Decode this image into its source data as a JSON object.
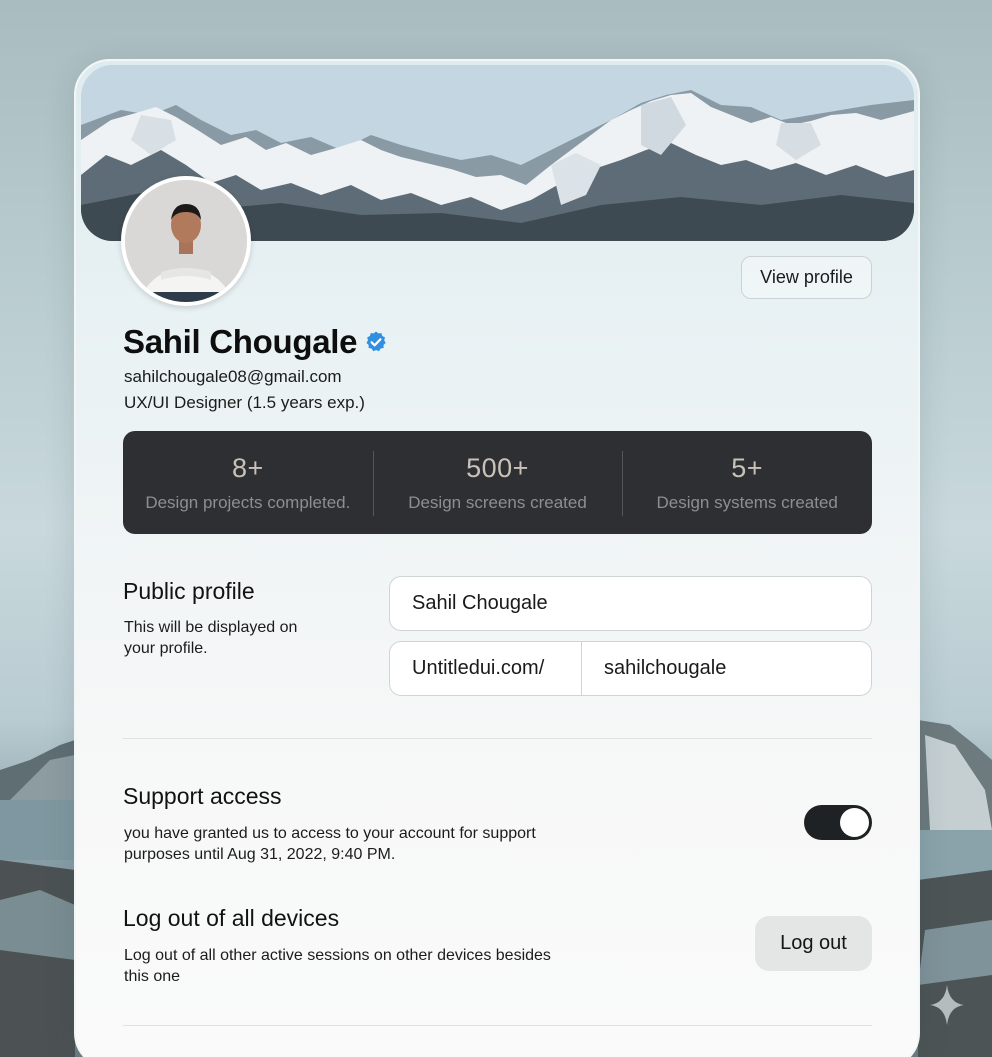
{
  "profile": {
    "name": "Sahil Chougale",
    "email": "sahilchougale08@gmail.com",
    "role": "UX/UI Designer (1.5 years exp.)",
    "view_profile_label": "View profile",
    "verified_icon": "verified-badge-icon",
    "accent_color": "#2f8fe0"
  },
  "stats": [
    {
      "value": "8+",
      "label": "Design projects completed."
    },
    {
      "value": "500+",
      "label": "Design screens created"
    },
    {
      "value": "5+",
      "label": "Design systems created"
    }
  ],
  "public_profile": {
    "title": "Public profile",
    "description_line1": "This will be displayed on",
    "description_line2": "your profile.",
    "name_value": "Sahil Chougale",
    "url_prefix": "Untitledui.com/",
    "url_value": "sahilchougale"
  },
  "support_access": {
    "title": "Support access",
    "description_line1": "you have granted us to access to your account for support",
    "description_line2": "purposes until Aug 31, 2022, 9:40 PM.",
    "toggle_on": true
  },
  "logout_all": {
    "title": "Log out of all devices",
    "description_line1": "Log out of all other active sessions on other devices besides",
    "description_line2": "this one",
    "button_label": "Log out"
  }
}
